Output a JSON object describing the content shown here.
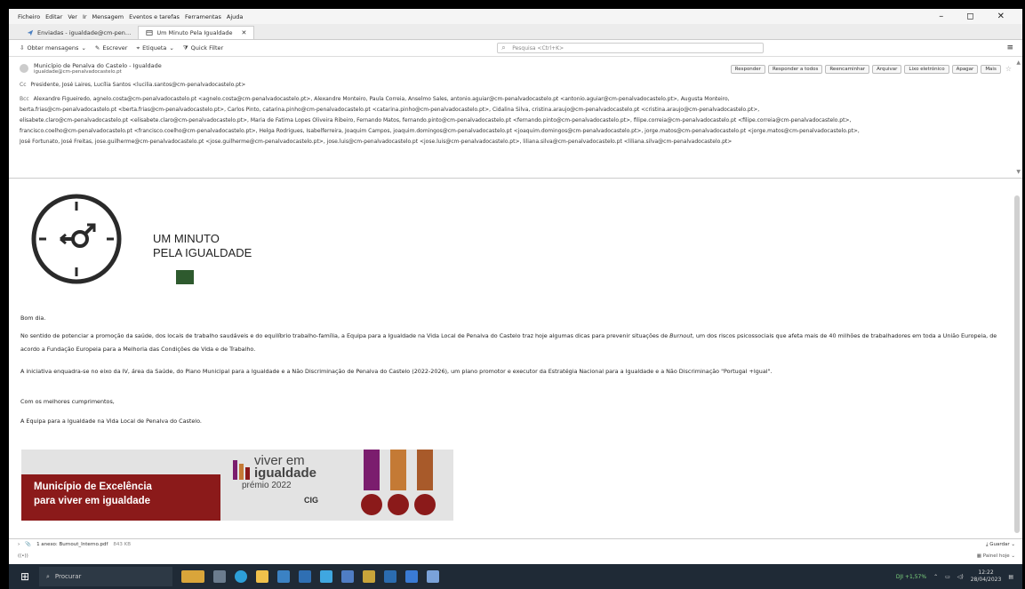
{
  "menubar": {
    "items": [
      "Ficheiro",
      "Editar",
      "Ver",
      "Ir",
      "Mensagem",
      "Eventos e tarefas",
      "Ferramentas",
      "Ajuda"
    ],
    "window_controls": [
      "–",
      "◻",
      "✕"
    ]
  },
  "tabs": [
    {
      "label": "Enviadas - igualdade@cm-pen…"
    },
    {
      "label": "Um Minuto Pela Igualdade",
      "close": "✕"
    }
  ],
  "toolbar": {
    "get_messages": "Obter mensagens",
    "write": "Escrever",
    "tag": "Etiqueta",
    "quick_filter": "Quick Filter",
    "search_placeholder": "Pesquisa <Ctrl+K>"
  },
  "header": {
    "from_name": "Município de Penalva do Castelo - Igualdade",
    "from_email": "igualdade@cm-penalvadocastelo.pt",
    "actions": [
      "Responder",
      "Responder a todos",
      "Reencaminhar",
      "Arquivar",
      "Lixo eletrónico",
      "Apagar",
      "Mais"
    ],
    "cc_label": "Cc",
    "cc": "Presidente, José Laires, Lucília Santos <lucilia.santos@cm-penalvadocastelo.pt>",
    "bcc_label": "Bcc",
    "bcc_lines": [
      "Alexandre Figueiredo, agnelo.costa@cm-penalvadocastelo.pt <agnelo.costa@cm-penalvadocastelo.pt>, Alexandre Monteiro, Paula Correia, Anselmo Sales, antonio.aguiar@cm-penalvadocastelo.pt <antonio.aguiar@cm-penalvadocastelo.pt>, Augusta Monteiro,",
      "berta.frias@cm-penalvadocastelo.pt <berta.frias@cm-penalvadocastelo.pt>, Carlos Pinto, catarina.pinho@cm-penalvadocastelo.pt <catarina.pinho@cm-penalvadocastelo.pt>, Cidalina Silva, cristina.araujo@cm-penalvadocastelo.pt <cristina.araujo@cm-penalvadocastelo.pt>,",
      "elisabete.claro@cm-penalvadocastelo.pt <elisabete.claro@cm-penalvadocastelo.pt>, Maria de Fatima Lopes Oliveira Ribeiro, Fernando Matos, fernando.pinto@cm-penalvadocastelo.pt <fernando.pinto@cm-penalvadocastelo.pt>, filipe.correia@cm-penalvadocastelo.pt <filipe.correia@cm-penalvadocastelo.pt>,",
      "francisco.coelho@cm-penalvadocastelo.pt <francisco.coelho@cm-penalvadocastelo.pt>, Helga Rodrigues, Isabelferreira, Joaquim Campos, joaquim.domingos@cm-penalvadocastelo.pt <joaquim.domingos@cm-penalvadocastelo.pt>, jorge.matos@cm-penalvadocastelo.pt <jorge.matos@cm-penalvadocastelo.pt>,",
      "José Fortunato, José Freitas, jose.guilherme@cm-penalvadocastelo.pt <jose.guilherme@cm-penalvadocastelo.pt>, jose.luis@cm-penalvadocastelo.pt <jose.luis@cm-penalvadocastelo.pt>, liliana.silva@cm-penalvadocastelo.pt <liliana.silva@cm-penalvadocastelo.pt>"
    ]
  },
  "body": {
    "logo_title_1": "UM MINUTO",
    "logo_title_2": "PELA IGUALDADE",
    "greeting": "Bom dia.",
    "main_pre": "No sentido de potenciar a promoção da saúde, dos locais de trabalho saudáveis e do equilíbrio trabalho-família, a Equipa para a Igualdade na Vida Local de Penalva do Castelo traz hoje algumas dicas para prevenir situações de ",
    "main_italic": "Burnout",
    "main_post": ", um dos riscos psicossociais que afeta mais de 40 milhões de trabalhadores em toda a União Europeia, de acordo a Fundação Europeia para a Melhoria das Condições de Vida e de Trabalho.",
    "initiative": "A iniciativa enquadra-se no eixo da IV, área da Saúde, do Plano Municipal para a Igualdade e a Não Discriminação de Penalva do Castelo (2022-2026), um plano promotor e executor da Estratégia Nacional para a Igualdade e a Não Discriminação \"Portugal +Igual\".",
    "closing": "Com os melhores cumprimentos,",
    "signature": "A Equipa para a Igualdade na Vida Local de Penalva do Castelo."
  },
  "banner": {
    "red_line_1": "Município de Excelência",
    "red_line_2": "para viver em igualdade",
    "viver_1": "viver em",
    "viver_2": "igualdade",
    "viver_3": "prémio 2022",
    "cig": "CIG",
    "colors": {
      "red": "#8b1a1a",
      "purple": "#7b1d6e",
      "orange": "#c47a35",
      "brown": "#a85a2a"
    }
  },
  "attachment": {
    "label": "1 anexo: Burnout_Interno.pdf",
    "size": "843 KB",
    "save": "Guardar"
  },
  "status": {
    "left": "((•))",
    "panel_today": "Painel hoje"
  },
  "taskbar": {
    "search_placeholder": "Procurar",
    "stock": "DJI +1,57%",
    "time": "12:22",
    "date": "28/04/2023"
  }
}
